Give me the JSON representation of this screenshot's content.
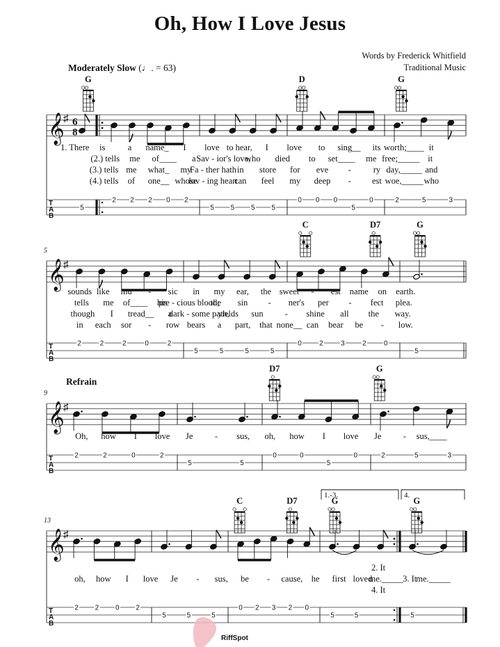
{
  "header": {
    "title": "Oh, How I Love Jesus",
    "words_credit": "Words by Frederick Whitfield",
    "music_credit": "Traditional Music",
    "tempo_text": "Moderately Slow",
    "tempo_mark": "(♩. = 63)",
    "key_signature": "G major (1 sharp)",
    "time_signature": "6/8"
  },
  "watermark": {
    "text": "RiffSpot",
    "color": "#f2b8c0",
    "text_color": "#d8d8d8"
  },
  "systems": [
    {
      "number": "",
      "label": "",
      "chords": [
        {
          "name": "G",
          "measure": 0,
          "pos": 0.45
        },
        {
          "name": "D",
          "measure": 3,
          "pos": 0.08
        },
        {
          "name": "G",
          "measure": 4,
          "pos": 0.12
        }
      ],
      "measures": [
        {
          "notes": [
            {
              "p": "G4",
              "d": "8"
            }
          ],
          "tab": [
            {
              "s": 2,
              "f": "5"
            }
          ],
          "pickup": true
        },
        {
          "notes": [
            {
              "p": "B4",
              "d": "4"
            },
            {
              "p": "B4",
              "d": "8"
            },
            {
              "p": "B4",
              "d": "8b"
            },
            {
              "p": "A4",
              "d": "8b"
            },
            {
              "p": "B4",
              "d": "8b"
            }
          ],
          "tab": [
            {
              "s": 1,
              "f": "2"
            },
            {
              "s": 1,
              "f": "2"
            },
            {
              "s": 1,
              "f": "2"
            },
            {
              "s": 1,
              "f": "0"
            },
            {
              "s": 1,
              "f": "2"
            }
          ],
          "repeat_start": true
        },
        {
          "notes": [
            {
              "p": "G4",
              "d": "4"
            },
            {
              "p": "G4",
              "d": "8"
            },
            {
              "p": "G4",
              "d": "4"
            },
            {
              "p": "G4",
              "d": "8"
            }
          ],
          "tab": [
            {
              "s": 2,
              "f": "5"
            },
            {
              "s": 2,
              "f": "5"
            },
            {
              "s": 2,
              "f": "5"
            },
            {
              "s": 2,
              "f": "5"
            }
          ]
        },
        {
          "notes": [
            {
              "p": "A4",
              "d": "4"
            },
            {
              "p": "A4",
              "d": "8"
            },
            {
              "p": "A4",
              "d": "8b"
            },
            {
              "p": "G4",
              "d": "8b"
            },
            {
              "p": "A4",
              "d": "8b"
            }
          ],
          "tab": [
            {
              "s": 1,
              "f": "0"
            },
            {
              "s": 1,
              "f": "0"
            },
            {
              "s": 1,
              "f": "0"
            },
            {
              "s": 2,
              "f": "5"
            },
            {
              "s": 1,
              "f": "0"
            }
          ]
        },
        {
          "notes": [
            {
              "p": "B4",
              "d": "4."
            },
            {
              "p": "D5",
              "d": "4"
            },
            {
              "p": "C5",
              "d": "8"
            }
          ],
          "tab": [
            {
              "s": 1,
              "f": "2"
            },
            {
              "s": 1,
              "f": "5"
            },
            {
              "s": 1,
              "f": "3"
            }
          ]
        }
      ],
      "lyrics": [
        [
          "1. There",
          "is",
          "a",
          "name_",
          "I",
          "love",
          "to hear,",
          "I",
          "love",
          "to",
          "sing__",
          "its",
          "worth;____",
          "it"
        ],
        [
          "(2.) tells",
          "me",
          "of____",
          "a",
          "Sav - ior's love,",
          "who",
          "died",
          "to",
          "set____",
          "me",
          "free;_____",
          "it"
        ],
        [
          "(3.) tells",
          "me",
          "what_",
          "my",
          "Fa - ther hath",
          "in",
          "store",
          "for",
          "eve",
          "-",
          "ry",
          "day,_____",
          "and"
        ],
        [
          "(4.) tells",
          "of",
          "one__",
          "whose",
          "lov - ing heart",
          "can",
          "feel",
          "my",
          "deep",
          "-",
          "est",
          "woe,_____",
          "who"
        ]
      ]
    },
    {
      "number": "5",
      "label": "",
      "chords": [
        {
          "name": "C",
          "measure": 2,
          "pos": 0.1
        },
        {
          "name": "D7",
          "measure": 2,
          "pos": 0.72
        },
        {
          "name": "G",
          "measure": 3,
          "pos": 0.2
        }
      ],
      "measures": [
        {
          "notes": [
            {
              "p": "B4",
              "d": "4"
            },
            {
              "p": "B4",
              "d": "8"
            },
            {
              "p": "B4",
              "d": "8b"
            },
            {
              "p": "A4",
              "d": "8b"
            },
            {
              "p": "B4",
              "d": "8b"
            }
          ],
          "tab": [
            {
              "s": 1,
              "f": "2"
            },
            {
              "s": 1,
              "f": "2"
            },
            {
              "s": 1,
              "f": "2"
            },
            {
              "s": 1,
              "f": "0"
            },
            {
              "s": 1,
              "f": "2"
            }
          ]
        },
        {
          "notes": [
            {
              "p": "G4",
              "d": "4"
            },
            {
              "p": "G4",
              "d": "8"
            },
            {
              "p": "G4",
              "d": "4"
            },
            {
              "p": "G4",
              "d": "8"
            }
          ],
          "tab": [
            {
              "s": 2,
              "f": "5"
            },
            {
              "s": 2,
              "f": "5"
            },
            {
              "s": 2,
              "f": "5"
            },
            {
              "s": 2,
              "f": "5"
            }
          ]
        },
        {
          "notes": [
            {
              "p": "A4",
              "d": "8b"
            },
            {
              "p": "B4",
              "d": "8b"
            },
            {
              "p": "C5",
              "d": "8b"
            },
            {
              "p": "B4",
              "d": "4"
            },
            {
              "p": "A4",
              "d": "8"
            }
          ],
          "tab": [
            {
              "s": 1,
              "f": "0"
            },
            {
              "s": 1,
              "f": "2"
            },
            {
              "s": 1,
              "f": "3"
            },
            {
              "s": 1,
              "f": "2"
            },
            {
              "s": 1,
              "f": "0"
            }
          ]
        },
        {
          "notes": [
            {
              "p": "G4",
              "d": "2."
            }
          ],
          "tab": [
            {
              "s": 2,
              "f": "5"
            }
          ],
          "final_double": true
        }
      ],
      "lyrics": [
        [
          "sounds",
          "like",
          "mu",
          "-",
          "sic",
          "in",
          "my",
          "ear,",
          "the",
          "sweet",
          "-",
          "est",
          "name",
          "on",
          "earth."
        ],
        [
          "tells",
          "me",
          "of____",
          "his",
          "pre - cious blood;",
          "the",
          "sin",
          "-",
          "ner's",
          "per",
          "-",
          "fect",
          "plea."
        ],
        [
          "though",
          "I",
          "tread__",
          "a",
          "dark - some path,",
          "yields",
          "sun",
          "-",
          "shine",
          "all",
          "the",
          "way."
        ],
        [
          "in",
          "each",
          "sor",
          "-",
          "row",
          "bears",
          "a",
          "part,",
          "that",
          "none__",
          "can",
          "bear",
          "be",
          "-",
          "low."
        ]
      ]
    },
    {
      "number": "9",
      "label": "Refrain",
      "chords": [
        {
          "name": "D7",
          "measure": 2,
          "pos": 0.05
        },
        {
          "name": "G",
          "measure": 3,
          "pos": 0.02
        }
      ],
      "measures": [
        {
          "notes": [
            {
              "p": "B4",
              "d": "4."
            },
            {
              "p": "B4",
              "d": "8b"
            },
            {
              "p": "A4",
              "d": "8b"
            },
            {
              "p": "B4",
              "d": "8b"
            }
          ],
          "tab": [
            {
              "s": 1,
              "f": "2"
            },
            {
              "s": 1,
              "f": "2"
            },
            {
              "s": 1,
              "f": "0"
            },
            {
              "s": 1,
              "f": "2"
            }
          ]
        },
        {
          "notes": [
            {
              "p": "G4",
              "d": "4."
            },
            {
              "p": "G4",
              "d": "4."
            }
          ],
          "tab": [
            {
              "s": 2,
              "f": "5"
            },
            {
              "s": 2,
              "f": "5"
            }
          ]
        },
        {
          "notes": [
            {
              "p": "A4",
              "d": "4."
            },
            {
              "p": "A4",
              "d": "8b"
            },
            {
              "p": "G4",
              "d": "8b"
            },
            {
              "p": "A4",
              "d": "8b"
            }
          ],
          "tab": [
            {
              "s": 1,
              "f": "0"
            },
            {
              "s": 1,
              "f": "0"
            },
            {
              "s": 2,
              "f": "5"
            },
            {
              "s": 1,
              "f": "0"
            }
          ]
        },
        {
          "notes": [
            {
              "p": "B4",
              "d": "4."
            },
            {
              "p": "D5",
              "d": "4"
            },
            {
              "p": "C5",
              "d": "8"
            }
          ],
          "tab": [
            {
              "s": 1,
              "f": "2"
            },
            {
              "s": 1,
              "f": "5"
            },
            {
              "s": 1,
              "f": "3"
            }
          ]
        }
      ],
      "lyrics": [
        [
          "Oh,",
          "how",
          "I",
          "love",
          "Je",
          "-",
          "sus,",
          "oh,",
          "how",
          "I",
          "love",
          "Je",
          "-",
          "sus,____"
        ]
      ]
    },
    {
      "number": "13",
      "label": "",
      "endings": [
        "1.-3.",
        "4."
      ],
      "chords": [
        {
          "name": "C",
          "measure": 2,
          "pos": 0.05
        },
        {
          "name": "D7",
          "measure": 2,
          "pos": 0.62
        },
        {
          "name": "G",
          "measure": 3,
          "pos": 0.1
        },
        {
          "name": "G",
          "measure": 4,
          "pos": 0.15
        }
      ],
      "measures": [
        {
          "notes": [
            {
              "p": "B4",
              "d": "4."
            },
            {
              "p": "B4",
              "d": "8b"
            },
            {
              "p": "A4",
              "d": "8b"
            },
            {
              "p": "B4",
              "d": "8b"
            }
          ],
          "tab": [
            {
              "s": 1,
              "f": "2"
            },
            {
              "s": 1,
              "f": "2"
            },
            {
              "s": 1,
              "f": "0"
            },
            {
              "s": 1,
              "f": "2"
            }
          ]
        },
        {
          "notes": [
            {
              "p": "G4",
              "d": "4."
            },
            {
              "p": "G4",
              "d": "4"
            },
            {
              "p": "G4",
              "d": "8"
            }
          ],
          "tab": [
            {
              "s": 2,
              "f": "5"
            },
            {
              "s": 2,
              "f": "5"
            },
            {
              "s": 2,
              "f": "5"
            }
          ]
        },
        {
          "notes": [
            {
              "p": "A4",
              "d": "8b"
            },
            {
              "p": "B4",
              "d": "8b"
            },
            {
              "p": "C5",
              "d": "8b"
            },
            {
              "p": "B4",
              "d": "4"
            },
            {
              "p": "A4",
              "d": "8"
            }
          ],
          "tab": [
            {
              "s": 1,
              "f": "0"
            },
            {
              "s": 1,
              "f": "2"
            },
            {
              "s": 1,
              "f": "3"
            },
            {
              "s": 1,
              "f": "2"
            },
            {
              "s": 1,
              "f": "0"
            }
          ]
        },
        {
          "notes": [
            {
              "p": "G4",
              "d": "4."
            },
            {
              "p": "G4",
              "d": "4"
            },
            {
              "p": "G4",
              "d": "8"
            }
          ],
          "tab": [
            {
              "s": 2,
              "f": "5"
            },
            {
              "s": 2,
              "f": "5"
            }
          ],
          "repeat_end": true,
          "tie": true
        },
        {
          "notes": [
            {
              "p": "G4",
              "d": "4."
            },
            {
              "p": "G4",
              "d": "4"
            }
          ],
          "tab": [
            {
              "s": 2,
              "f": "5"
            }
          ],
          "final": true,
          "tie": true
        }
      ],
      "lyrics": [
        [
          "oh,",
          "how",
          "I",
          "love",
          "Je",
          "-",
          "sus,",
          "be",
          "-",
          "cause,",
          "he",
          "first",
          "loved",
          "me._____",
          "3. It",
          "me._____"
        ]
      ],
      "verse_cues": [
        "2. It",
        "3. It",
        "4. It"
      ]
    }
  ]
}
